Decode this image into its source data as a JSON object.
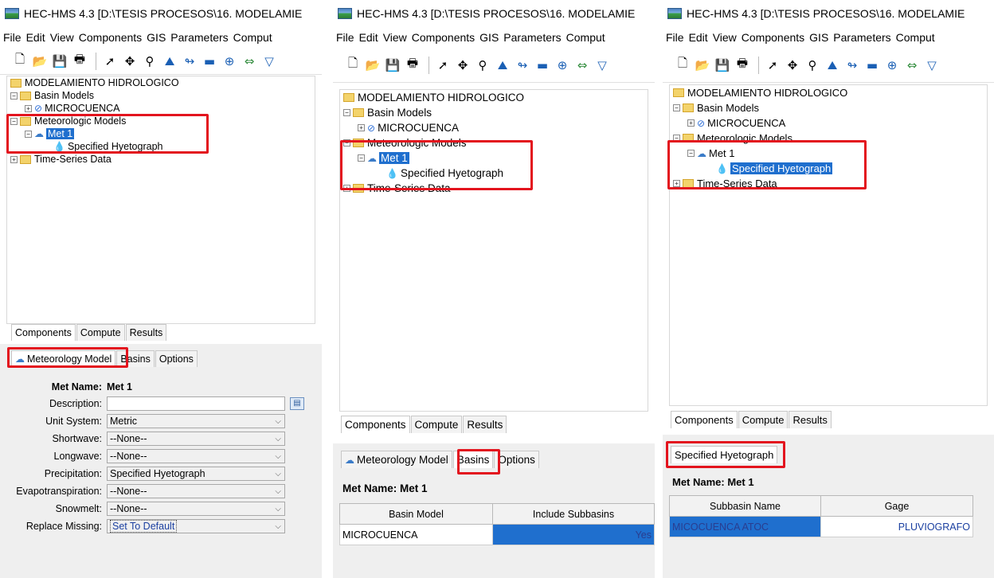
{
  "app": {
    "title": "HEC-HMS 4.3 [D:\\TESIS PROCESOS\\16. MODELAMIE",
    "menu": [
      "File",
      "Edit",
      "View",
      "Components",
      "GIS",
      "Parameters",
      "Comput"
    ]
  },
  "tree": {
    "root": "MODELAMIENTO HIDROLOGICO",
    "basin_models": "Basin Models",
    "microcuenca": "MICROCUENCA",
    "meteorologic_models": "Meteorologic Models",
    "met1": "Met 1",
    "specified_hyetograph": "Specified Hyetograph",
    "time_series": "Time-Series Data"
  },
  "nav_tabs": [
    "Components",
    "Compute",
    "Results"
  ],
  "panel1": {
    "editor_tabs": [
      "Meteorology Model",
      "Basins",
      "Options"
    ],
    "met_name_label": "Met Name:",
    "met_name_value": "Met 1",
    "fields": [
      {
        "label": "Description:",
        "value": ""
      },
      {
        "label": "Unit System:",
        "value": "Metric"
      },
      {
        "label": "Shortwave:",
        "value": "--None--"
      },
      {
        "label": "Longwave:",
        "value": "--None--"
      },
      {
        "label": "Precipitation:",
        "value": "Specified Hyetograph"
      },
      {
        "label": "Evapotranspiration:",
        "value": "--None--"
      },
      {
        "label": "Snowmelt:",
        "value": "--None--"
      },
      {
        "label": "Replace Missing:",
        "value": "Set To Default"
      }
    ]
  },
  "panel2": {
    "editor_tabs": [
      "Meteorology Model",
      "Basins",
      "Options"
    ],
    "met_name": "Met Name: Met 1",
    "columns": [
      "Basin Model",
      "Include Subbasins"
    ],
    "rows": [
      [
        "MICROCUENCA",
        "Yes"
      ]
    ]
  },
  "panel3": {
    "editor_tab": "Specified Hyetograph",
    "met_name": "Met Name: Met 1",
    "columns": [
      "Subbasin Name",
      "Gage"
    ],
    "rows": [
      [
        "MICOCUENCA ATOC",
        "PLUVIOGRAFO"
      ]
    ]
  },
  "colors": {
    "highlight_box": "#e3141e",
    "selection": "#1f6fce"
  }
}
